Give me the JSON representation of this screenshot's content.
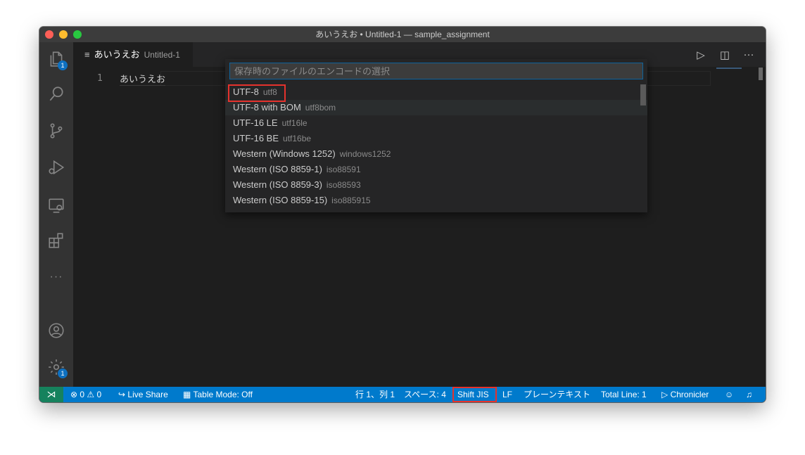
{
  "window": {
    "title": "あいうえお • Untitled-1 — sample_assignment"
  },
  "activity_bar": {
    "explorer_badge": "1",
    "more": "···",
    "settings_badge": "1"
  },
  "tab": {
    "icon": "≡",
    "label": "あいうえお",
    "description": "Untitled-1"
  },
  "editor": {
    "line_number": "1",
    "line_text": "あいうえお"
  },
  "editor_actions": {
    "run": "▷",
    "split": "◫",
    "more": "···"
  },
  "quick_pick": {
    "placeholder": "保存時のファイルのエンコードの選択",
    "items": [
      {
        "label": "UTF-8",
        "description": "utf8"
      },
      {
        "label": "UTF-8 with BOM",
        "description": "utf8bom"
      },
      {
        "label": "UTF-16 LE",
        "description": "utf16le"
      },
      {
        "label": "UTF-16 BE",
        "description": "utf16be"
      },
      {
        "label": "Western (Windows 1252)",
        "description": "windows1252"
      },
      {
        "label": "Western (ISO 8859-1)",
        "description": "iso88591"
      },
      {
        "label": "Western (ISO 8859-3)",
        "description": "iso88593"
      },
      {
        "label": "Western (ISO 8859-15)",
        "description": "iso885915"
      }
    ]
  },
  "status_bar": {
    "remote_icon": "⋊",
    "problems": "⊗ 0 ⚠ 0",
    "live_share": "Live Share",
    "table_mode": "Table Mode: Off",
    "position": "行 1、列 1",
    "spaces": "スペース: 4",
    "encoding": "Shift JIS",
    "eol": "LF",
    "language": "プレーンテキスト",
    "total_line": "Total Line: 1",
    "chronicler": "Chronicler"
  },
  "colors": {
    "status_bar": "#007acc",
    "remote": "#16825d",
    "highlight_box": "#e5322d",
    "badge": "#0e70c0"
  }
}
